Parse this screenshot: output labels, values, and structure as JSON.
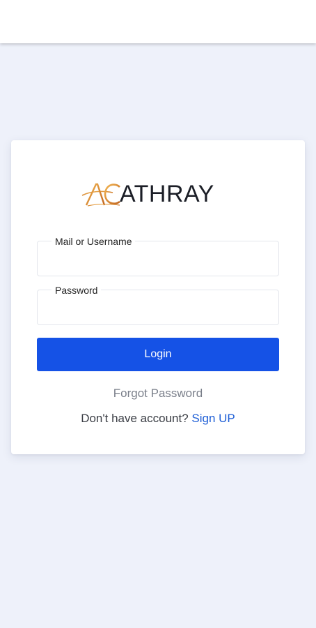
{
  "app": {
    "logo_text": "ATHRAY",
    "logo_mark_letters": "AC"
  },
  "login_form": {
    "username_label": "Mail or Username",
    "username_value": "",
    "password_label": "Password",
    "password_value": "",
    "login_button": "Login",
    "forgot_password": "Forgot Password",
    "no_account_text": "Don't have account?",
    "signup_link": "Sign UP"
  },
  "colors": {
    "background": "#eef1fa",
    "primary_button": "#1552e6",
    "link": "#1f5fd6",
    "logo_mark": "#d9892e"
  }
}
